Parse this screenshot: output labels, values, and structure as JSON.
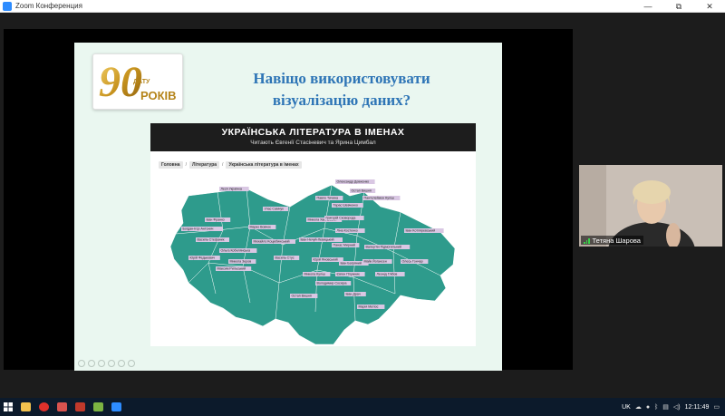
{
  "window": {
    "title": "Zoom Конференция",
    "controls": {
      "minimize": "—",
      "maximize": "⧉",
      "close": "✕"
    }
  },
  "slide": {
    "logo_number": "90",
    "logo_top": "ДАТУ",
    "logo_bottom": "РОКІВ",
    "title_line1": "Навіщо використовувати",
    "title_line2": "візуалізацію даних?"
  },
  "site": {
    "title": "УКРАЇНСЬКА ЛІТЕРАТУРА В ІМЕНАХ",
    "subtitle": "Читають Євгенії Стасіневич та Ярина Цимбал",
    "breadcrumb": [
      "Головна",
      "Література",
      "Українська література в іменах"
    ]
  },
  "map": {
    "fill_color": "#2e9b8c",
    "label_color": "#d9c7e3",
    "labels": [
      "Леся Українка",
      "Олександр Довженко",
      "Остап Вишня",
      "Пантелеймон Куліш",
      "Павло Тичина",
      "Улас Самчук",
      "Іван Франко",
      "Тарас Шевченко",
      "Микола Хвильовий",
      "Григорій Сковорода",
      "Ліна Костенко",
      "Іван Котляревський",
      "Василь Стефаник",
      "Ольга Кобилянська",
      "Марко Вовчок",
      "Михайло Коцюбинський",
      "Іван Нечуй-Левицький",
      "Панас Мирний",
      "Валер'ян Підмогильний",
      "Максим Рильський",
      "Микола Зеров",
      "Василь Стус",
      "Юрій Яновський",
      "Іван Багряний",
      "Майк Йогансен",
      "Олесь Гончар",
      "Микола Куліш",
      "Володимир Сосюра",
      "Євген Плужник",
      "Богдан-Ігор Антонич",
      "Юрій Федькович",
      "Леонід Глібов",
      "Іван Драч",
      "Остап Вишня ",
      "Марія Матіос"
    ]
  },
  "participant": {
    "name": "Тетяна Шарова"
  },
  "taskbar": {
    "language": "UK",
    "time": "12:11:49"
  }
}
